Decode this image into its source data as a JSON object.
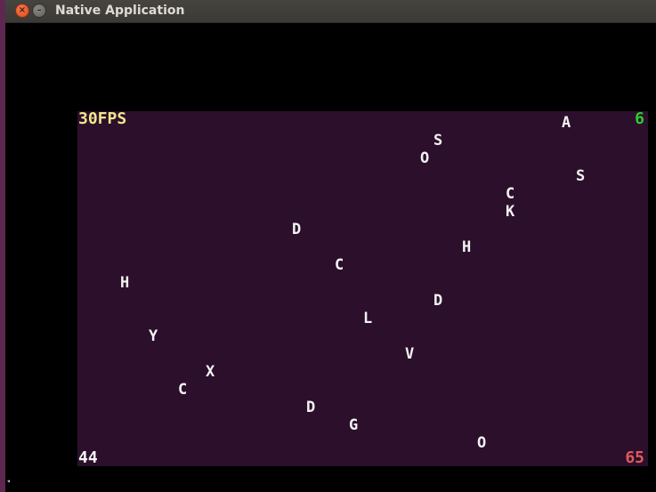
{
  "window": {
    "title": "Native Application",
    "close_glyph": "×",
    "minimize_glyph": "–"
  },
  "hud": {
    "fps": "30FPS",
    "top_right": "6",
    "bottom_left": "44",
    "bottom_right": "65"
  },
  "letters": [
    "A",
    "S",
    "O",
    "S",
    "C",
    "K",
    "D",
    "H",
    "C",
    "H",
    "D",
    "L",
    "Y",
    "V",
    "X",
    "C",
    "D",
    "G",
    "O"
  ],
  "colors": {
    "background": "#2b0f2b",
    "fps": "#f0e68c",
    "top_right": "#2ecc2e",
    "bottom_left": "#f3f3f3",
    "bottom_right": "#e05a5a",
    "letters": "#f3f3f3"
  }
}
